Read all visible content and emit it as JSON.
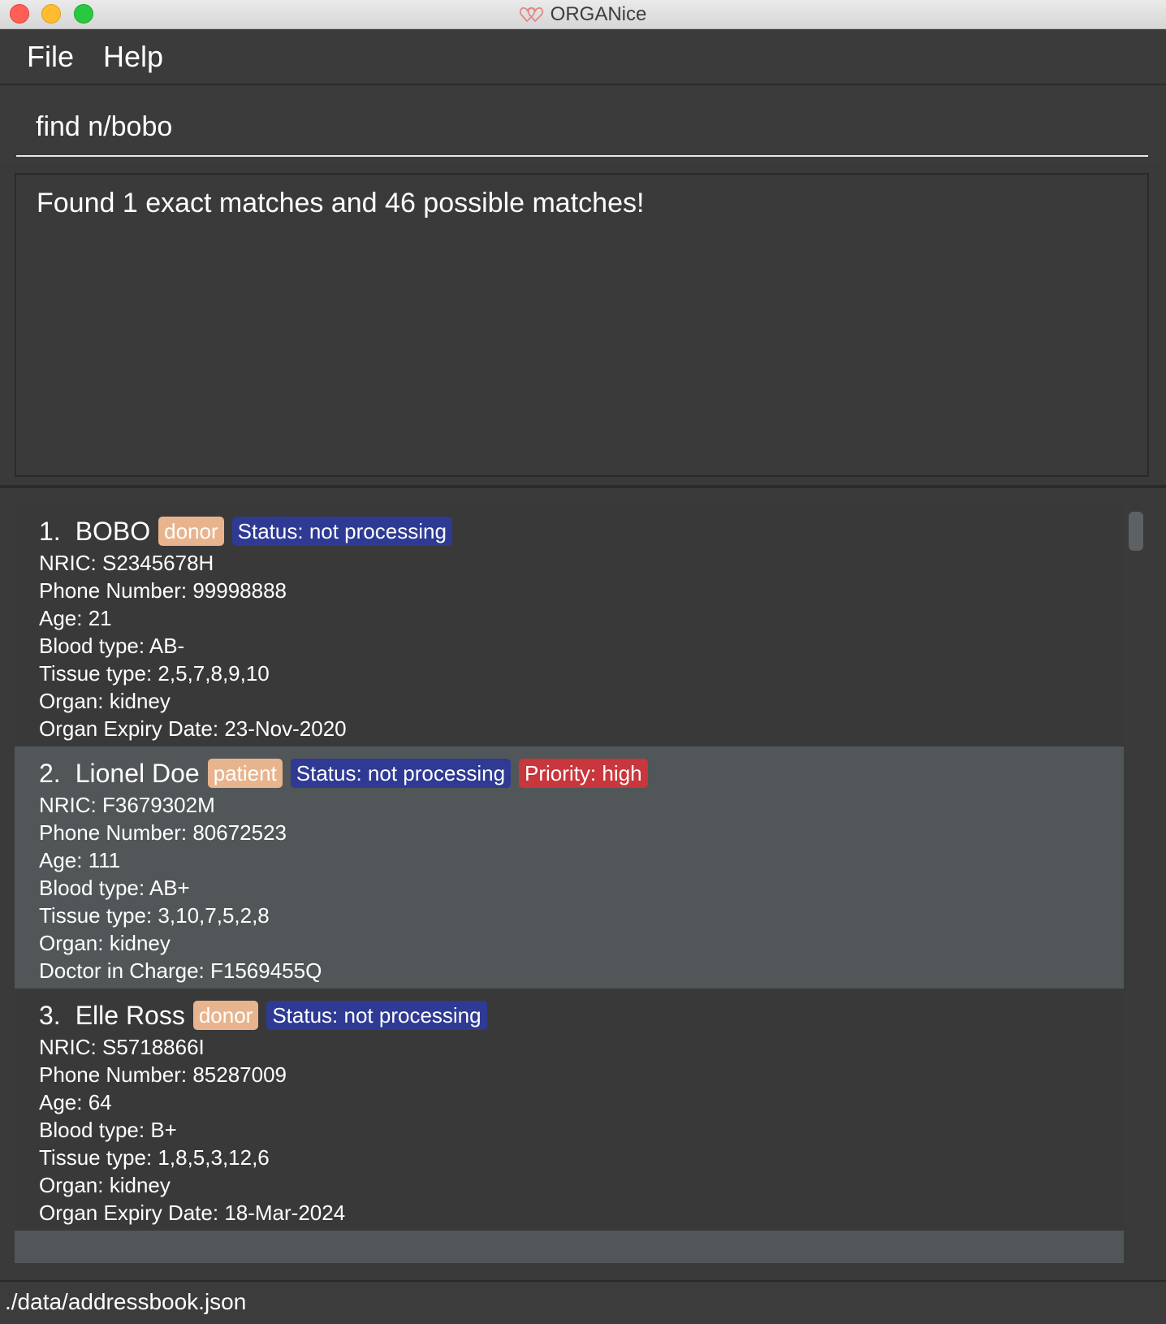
{
  "window": {
    "title": "ORGANice",
    "icon": "heart-icon"
  },
  "menu": {
    "file_label": "File",
    "help_label": "Help"
  },
  "command": {
    "value": "find n/bobo"
  },
  "result": {
    "message": "Found 1 exact matches and 46 possible matches!"
  },
  "persons": [
    {
      "index": "1.",
      "name": "BOBO",
      "role": "donor",
      "status": "Status: not processing",
      "priority": "",
      "fields": [
        "NRIC: S2345678H",
        "Phone Number: 99998888",
        "Age: 21",
        "Blood type: AB-",
        "Tissue type: 2,5,7,8,9,10",
        "Organ: kidney",
        "Organ Expiry Date: 23-Nov-2020"
      ]
    },
    {
      "index": "2.",
      "name": "Lionel Doe",
      "role": "patient",
      "status": "Status: not processing",
      "priority": "Priority: high",
      "fields": [
        "NRIC: F3679302M",
        "Phone Number: 80672523",
        "Age: 111",
        "Blood type: AB+",
        "Tissue type: 3,10,7,5,2,8",
        "Organ: kidney",
        "Doctor in Charge: F1569455Q"
      ]
    },
    {
      "index": "3.",
      "name": "Elle Ross",
      "role": "donor",
      "status": "Status: not processing",
      "priority": "",
      "fields": [
        "NRIC: S5718866I",
        "Phone Number: 85287009",
        "Age: 64",
        "Blood type: B+",
        "Tissue type: 1,8,5,3,12,6",
        "Organ: kidney",
        "Organ Expiry Date: 18-Mar-2024"
      ]
    }
  ],
  "statusbar": {
    "path": "./data/addressbook.json"
  },
  "colors": {
    "background": "#3a3a3b",
    "alt_card": "#515658",
    "tag_role": "#e8b48d",
    "tag_status": "#2e3a93",
    "tag_priority": "#c9363b"
  }
}
